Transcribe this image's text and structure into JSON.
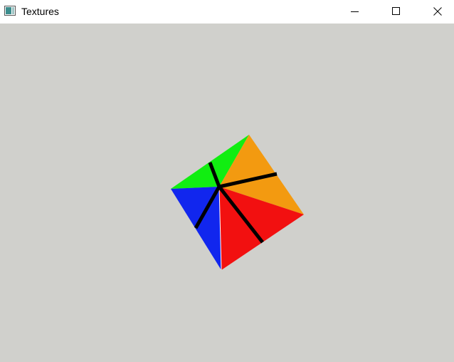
{
  "window": {
    "title": "Textures",
    "controls": {
      "minimize_icon": "minimize-icon",
      "maximize_icon": "maximize-icon",
      "close_icon": "close-icon"
    }
  },
  "scene": {
    "background_color": "#d0d0cc",
    "faces": [
      {
        "name": "green-face",
        "color": "#11ee11"
      },
      {
        "name": "orange-face",
        "color": "#f39a10"
      },
      {
        "name": "red-face",
        "color": "#f21010"
      },
      {
        "name": "blue-face",
        "color": "#1126ee"
      }
    ],
    "edge_color": "#000000"
  }
}
